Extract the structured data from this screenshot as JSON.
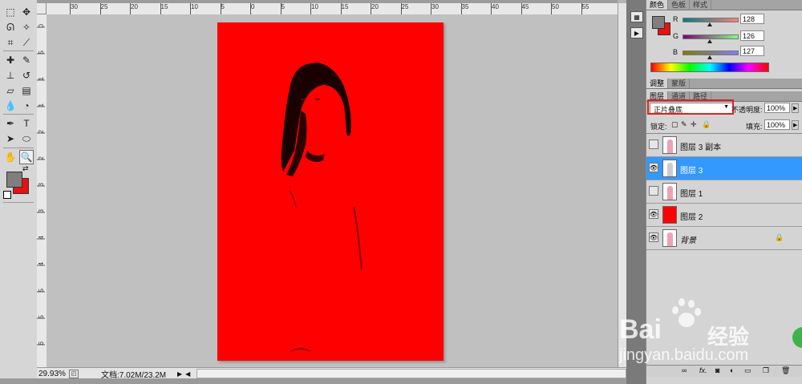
{
  "document": {
    "zoom": "29.93%",
    "doc_info": "文档:7.02M/23.2M",
    "ruler_top_ticks": [
      "30",
      "25",
      "20",
      "15",
      "10",
      "5",
      "0",
      "5",
      "10",
      "15",
      "20",
      "25",
      "30",
      "35",
      "40",
      "45",
      "50",
      "55"
    ],
    "ruler_left_ticks": [
      "0",
      "5",
      "1",
      "1",
      "2",
      "2",
      "3",
      "3",
      "4",
      "4",
      "5",
      "5",
      "6"
    ]
  },
  "color_panel": {
    "tabs": [
      "颜色",
      "色板",
      "样式"
    ],
    "r_label": "R",
    "r_value": "128",
    "g_label": "G",
    "g_value": "126",
    "b_label": "B",
    "b_value": "127",
    "fg_color": "#807e7f",
    "bg_color": "#e81010"
  },
  "adjust_panel": {
    "tabs": [
      "调整",
      "蒙版"
    ]
  },
  "layers_panel": {
    "tabs": [
      "图层",
      "通道",
      "路径"
    ],
    "blend_mode": "正片叠底",
    "opacity_label": "不透明度:",
    "opacity_value": "100%",
    "lock_label": "锁定:",
    "fill_label": "填充:",
    "fill_value": "100%",
    "layers": [
      {
        "name": "图层 3 副本",
        "visible": false,
        "selected": false,
        "thumb": "person"
      },
      {
        "name": "图层 3",
        "visible": true,
        "selected": true,
        "thumb": "person-bw"
      },
      {
        "name": "图层 1",
        "visible": false,
        "selected": false,
        "thumb": "person"
      },
      {
        "name": "图层 2",
        "visible": true,
        "selected": false,
        "thumb": "red"
      },
      {
        "name": "背景",
        "visible": true,
        "selected": false,
        "thumb": "person"
      }
    ],
    "footer_icons": [
      "link-icon",
      "fx-icon",
      "mask-icon",
      "adjustment-icon",
      "group-icon",
      "new-layer-icon",
      "trash-icon"
    ]
  },
  "watermark": {
    "brand": "Bai",
    "brand2": "经验",
    "url": "jingyan.baidu.com"
  },
  "accent": {
    "selection_blue": "#3399ff",
    "canvas_red": "#ff0000",
    "highlight_box": "#e02020"
  }
}
